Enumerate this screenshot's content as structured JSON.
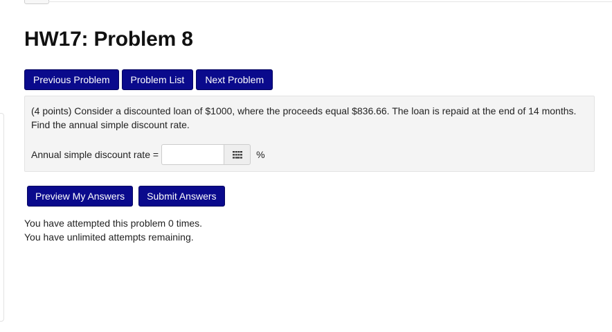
{
  "title": "HW17: Problem 8",
  "nav": {
    "previous_label": "Previous Problem",
    "list_label": "Problem List",
    "next_label": "Next Problem"
  },
  "problem": {
    "text": "(4 points) Consider a discounted loan of $1000, where the proceeds equal $836.66. The loan is repaid at the end of 14 months. Find the annual simple discount rate.",
    "answer_label": "Annual simple discount rate =",
    "answer_value": "",
    "keypad_icon": "keypad-icon",
    "unit": "%"
  },
  "actions": {
    "preview_label": "Preview My Answers",
    "submit_label": "Submit Answers"
  },
  "attempts": {
    "line1": "You have attempted this problem 0 times.",
    "line2": "You have unlimited attempts remaining."
  },
  "colors": {
    "button_bg": "#0a0a8c",
    "button_text": "#ffffff",
    "box_bg": "#f4f4f4"
  }
}
